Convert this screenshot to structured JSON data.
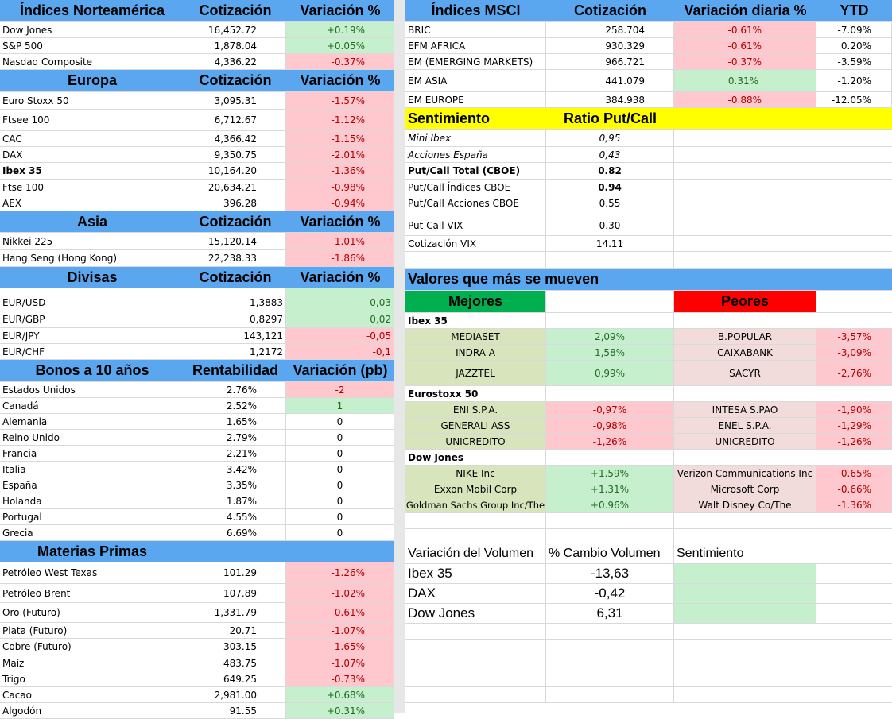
{
  "norteamerica": {
    "title": "Índices Norteamérica",
    "col2": "Cotización",
    "col3": "Variación %",
    "rows": [
      {
        "name": "Dow Jones",
        "value": "16,452.72",
        "change": "+0.19%"
      },
      {
        "name": "S&P 500",
        "value": "1,878.04",
        "change": "+0.05%"
      },
      {
        "name": "Nasdaq Composite",
        "value": "4,336.22",
        "change": "-0.37%"
      }
    ]
  },
  "europa": {
    "title": "Europa",
    "col2": "Cotización",
    "col3": "Variación %",
    "rows": [
      {
        "name": "Euro Stoxx 50",
        "value": "3,095.31",
        "change": "-1.57%"
      },
      {
        "name": "Ftsee 100",
        "value": "6,712.67",
        "change": "-1.12%"
      },
      {
        "name": "CAC",
        "value": "4,366.42",
        "change": "-1.15%"
      },
      {
        "name": "DAX",
        "value": "9,350.75",
        "change": "-2.01%"
      },
      {
        "name": "Ibex 35",
        "value": "10,164.20",
        "change": "-1.36%"
      },
      {
        "name": "Ftse 100",
        "value": "20,634.21",
        "change": "-0.98%"
      },
      {
        "name": "AEX",
        "value": "396.28",
        "change": "-0.94%"
      }
    ]
  },
  "asia": {
    "title": "Asia",
    "col2": "Cotización",
    "col3": "Variación %",
    "rows": [
      {
        "name": "Nikkei 225",
        "value": "15,120.14",
        "change": "-1.01%"
      },
      {
        "name": "Hang Seng (Hong Kong)",
        "value": "22,238.33",
        "change": "-1.86%"
      }
    ]
  },
  "divisas": {
    "title": "Divisas",
    "col2": "Cotización",
    "col3": "Variación %",
    "rows": [
      {
        "name": "EUR/USD",
        "value": "1,3883",
        "change": "0,03"
      },
      {
        "name": "EUR/GBP",
        "value": "0,8297",
        "change": "0,02"
      },
      {
        "name": "EUR/JPY",
        "value": "143,121",
        "change": "-0,05"
      },
      {
        "name": "EUR/CHF",
        "value": "1,2172",
        "change": "-0,1"
      }
    ]
  },
  "bonos": {
    "title": "Bonos a 10 años",
    "col2": "Rentabilidad",
    "col3": "Variación (pb)",
    "rows": [
      {
        "name": "Estados Unidos",
        "value": "2.76%",
        "change": "-2"
      },
      {
        "name": "Canadá",
        "value": "2.52%",
        "change": "1"
      },
      {
        "name": "Alemania",
        "value": "1.65%",
        "change": "0"
      },
      {
        "name": "Reino Unido",
        "value": "2.79%",
        "change": "0"
      },
      {
        "name": "Francia",
        "value": "2.21%",
        "change": "0"
      },
      {
        "name": "Italia",
        "value": "3.42%",
        "change": "0"
      },
      {
        "name": "España",
        "value": "3.35%",
        "change": "0"
      },
      {
        "name": "Holanda",
        "value": "1.87%",
        "change": "0"
      },
      {
        "name": "Portugal",
        "value": "4.55%",
        "change": "0"
      },
      {
        "name": "Grecia",
        "value": "6.69%",
        "change": "0"
      }
    ]
  },
  "materias": {
    "title": "Materias Primas",
    "rows": [
      {
        "name": "Petróleo West Texas",
        "value": "101.29",
        "change": "-1.26%"
      },
      {
        "name": "Petróleo Brent",
        "value": "107.89",
        "change": "-1.02%"
      },
      {
        "name": "Oro (Futuro)",
        "value": "1,331.79",
        "change": "-0.61%"
      },
      {
        "name": "Plata (Futuro)",
        "value": "20.71",
        "change": "-1.07%"
      },
      {
        "name": "Cobre (Futuro)",
        "value": "303.15",
        "change": "-1.65%"
      },
      {
        "name": "Maíz",
        "value": "483.75",
        "change": "-1.07%"
      },
      {
        "name": "Trigo",
        "value": "649.25",
        "change": "-0.73%"
      },
      {
        "name": "Cacao",
        "value": "2,981.00",
        "change": "+0.68%"
      },
      {
        "name": "Algodón",
        "value": "91.55",
        "change": "+0.31%"
      }
    ]
  },
  "msci": {
    "title": "Índices MSCI",
    "col2": "Cotización",
    "col3": "Variación diaria %",
    "col4": "YTD",
    "rows": [
      {
        "name": "BRIC",
        "value": "258.704",
        "change": "-0.61%",
        "ytd": "-7.09%"
      },
      {
        "name": "EFM AFRICA",
        "value": "930.329",
        "change": "-0.61%",
        "ytd": "0.20%"
      },
      {
        "name": "EM (EMERGING MARKETS)",
        "value": "966.721",
        "change": "-0.37%",
        "ytd": "-3.59%"
      },
      {
        "name": "EM ASIA",
        "value": "441.079",
        "change": "0.31%",
        "ytd": "-1.20%"
      },
      {
        "name": "EM EUROPE",
        "value": "384.938",
        "change": "-0.88%",
        "ytd": "-12.05%"
      }
    ]
  },
  "sentimiento": {
    "title": "Sentimiento",
    "col2": "Ratio Put/Call",
    "rows": [
      {
        "name": "Mini Ibex",
        "value": "0,95"
      },
      {
        "name": "Acciones España",
        "value": "0,43"
      },
      {
        "name": "Put/Call Total (CBOE)",
        "value": "0.82"
      },
      {
        "name": "Put/Call Índices CBOE",
        "value": "0.94"
      },
      {
        "name": "Put/Call Acciones CBOE",
        "value": "0.55"
      },
      {
        "name": "Put Call VIX",
        "value": "0.30"
      },
      {
        "name": "Cotización VIX",
        "value": "14.11"
      }
    ]
  },
  "valores": {
    "title": "Valores que más se mueven",
    "mejores": "Mejores",
    "peores": "Peores",
    "groups": [
      {
        "name": "Ibex 35",
        "rows": [
          {
            "best": "MEDIASET",
            "best_chg": "2,09%",
            "worst": "B.POPULAR",
            "worst_chg": "-3,57%"
          },
          {
            "best": "INDRA A",
            "best_chg": "1,58%",
            "worst": "CAIXABANK",
            "worst_chg": "-3,09%"
          },
          {
            "best": "JAZZTEL",
            "best_chg": "0,99%",
            "worst": "SACYR",
            "worst_chg": "-2,76%"
          }
        ]
      },
      {
        "name": "Eurostoxx 50",
        "rows": [
          {
            "best": "ENI S.P.A.",
            "best_chg": "-0,97%",
            "worst": "INTESA S.PAO",
            "worst_chg": "-1,90%"
          },
          {
            "best": "GENERALI ASS",
            "best_chg": "-0,98%",
            "worst": "ENEL S.P.A.",
            "worst_chg": "-1,29%"
          },
          {
            "best": "UNICREDITO",
            "best_chg": "-1,26%",
            "worst": "UNICREDITO",
            "worst_chg": "-1,26%"
          }
        ]
      },
      {
        "name": "Dow Jones",
        "rows": [
          {
            "best": "NIKE Inc",
            "best_chg": "+1.59%",
            "worst": "Verizon Communications Inc",
            "worst_chg": "-0.65%"
          },
          {
            "best": "Exxon Mobil Corp",
            "best_chg": "+1.31%",
            "worst": "Microsoft Corp",
            "worst_chg": "-0.66%"
          },
          {
            "best": "Goldman Sachs Group Inc/The",
            "best_chg": "+0.96%",
            "worst": "Walt Disney Co/The",
            "worst_chg": "-1.36%"
          }
        ]
      }
    ]
  },
  "volumen": {
    "col1": "Variación del Volumen",
    "col2": "% Cambio Volumen",
    "col3": "Sentimiento",
    "rows": [
      {
        "name": "Ibex 35",
        "value": "-13,63"
      },
      {
        "name": "DAX",
        "value": "-0,42"
      },
      {
        "name": "Dow Jones",
        "value": "6,31"
      }
    ]
  },
  "colors": {
    "header": "#5aa7f0",
    "positive_bg": "#c6efce",
    "negative_bg": "#ffc7ce",
    "sentiment_bg": "#ffff00",
    "best_bg": "#00b050",
    "worst_bg": "#ff0000"
  }
}
